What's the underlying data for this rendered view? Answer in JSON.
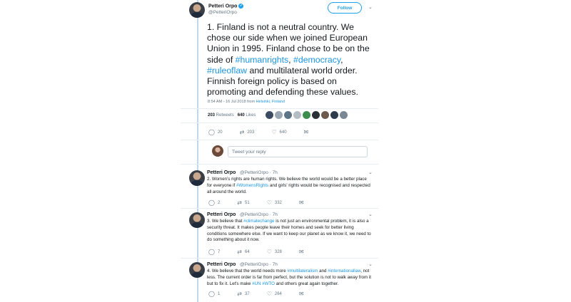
{
  "main": {
    "name": "Petteri Orpo",
    "handle": "@PetteriOrpo",
    "follow_label": "Follow",
    "text_1": "1. Finland is not a neutral country. We chose our side when we joined European Union in 1995. Finland chose to be on the side of ",
    "tag_1": "#humanrights",
    "text_2": ", ",
    "tag_2": "#democracy",
    "text_3": ", ",
    "tag_3": "#ruleoflaw",
    "text_4": " and multilateral world order. Finnish foreign policy is based on promoting and defending these values.",
    "time": "8:54 AM - 16 Jul 2018 from ",
    "location": "Helsinki, Finland",
    "retweets_count": "203",
    "retweets_label": " Retweets",
    "likes_count": "640",
    "likes_label": " Likes",
    "reply_count": "20",
    "retweet_count": "203",
    "like_count": "640"
  },
  "reply_box": {
    "placeholder": "Tweet your reply"
  },
  "replies": [
    {
      "name": "Petteri Orpo",
      "handle": "@PetteriOrpo · 7h",
      "text_1": "2. Women's rights are human rights. We believe the world would be a better place for everyone if ",
      "tag_1": "#WomensRights",
      "text_2": " and girls' rights would be recognised and respected all around the world.",
      "replies": "2",
      "retweets": "51",
      "likes": "332"
    },
    {
      "name": "Petteri Orpo",
      "handle": "@PetteriOrpo · 7h",
      "text_1": "3. We believe that ",
      "tag_1": "#climatechange",
      "text_2": " is not just an environmental problem, it is also a security threat. It makes people leave their homes and seek for better living conditions somewhere else. If we want to keep our planet as we know it, we need to do something about it now.",
      "replies": "7",
      "retweets": "64",
      "likes": "328"
    },
    {
      "name": "Petteri Orpo",
      "handle": "@PetteriOrpo · 7h",
      "text_1": "4. We believe that the world needs more ",
      "tag_1": "#multilateralism",
      "text_2": " and ",
      "tag_2": "#internationallaw",
      "text_3": ", not less. The current order is far from perfect, but the solution is not to walk away from it but to fix it. Let's make ",
      "tag_3": "#UN",
      "text_4": " ",
      "tag_4": "#WTO",
      "text_5": " and others great again together.",
      "replies": "1",
      "retweets": "37",
      "likes": "264"
    }
  ],
  "colors": {
    "accent": "#1da1f2",
    "link": "#1b95e0",
    "muted": "#657786",
    "thread_line": "#bfd8ee"
  },
  "icons": [
    "verified-icon",
    "chevron-down-icon",
    "reply-icon",
    "retweet-icon",
    "like-icon",
    "message-icon"
  ]
}
